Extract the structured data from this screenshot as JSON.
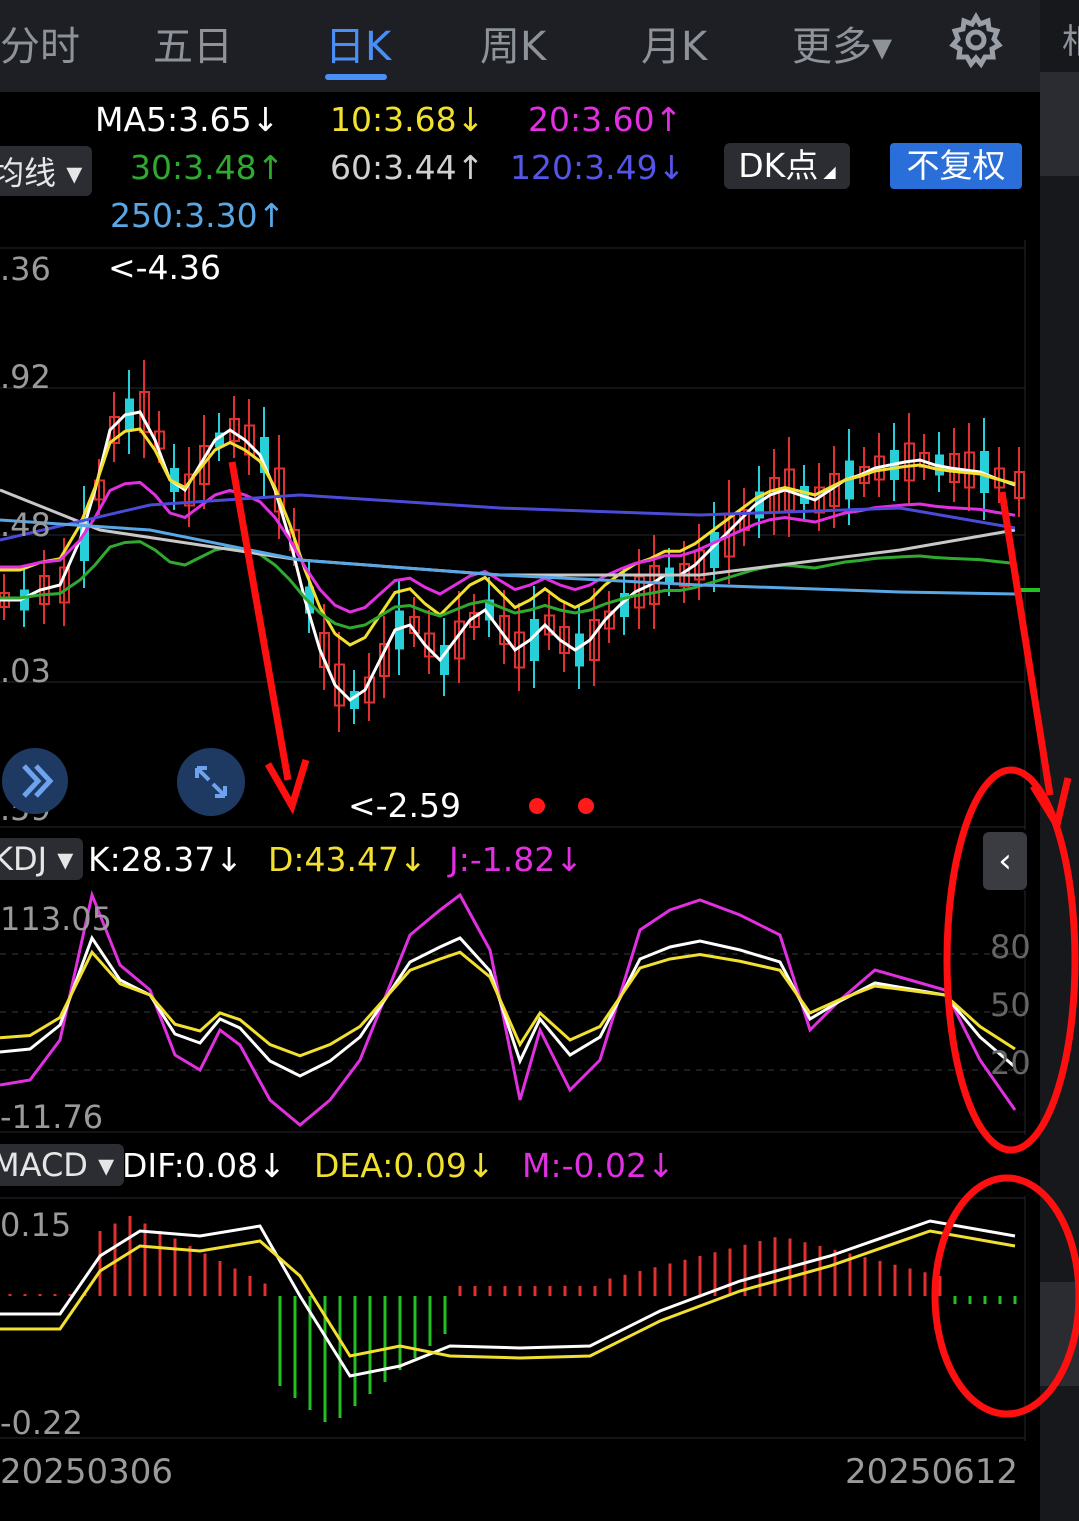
{
  "tabs": [
    {
      "label": "分时"
    },
    {
      "label": "五日"
    },
    {
      "label": "日K"
    },
    {
      "label": "周K"
    },
    {
      "label": "月K"
    },
    {
      "label": "更多▾"
    }
  ],
  "right_tab_partial": "相",
  "ma_legend": {
    "indicator_select": "均线",
    "ma5": "MA5:3.65↓",
    "ma10": "10:3.68↓",
    "ma20": "20:3.60↑",
    "ma30": "30:3.48↑",
    "ma60": "60:3.44↑",
    "ma120": "120:3.49↓",
    "ma250": "250:3.30↑",
    "dk_button": "DK点",
    "fuquan_button": "不复权"
  },
  "price_axis": {
    "l1": ".36",
    "l2": ".92",
    "l3": ".48",
    "l4": ".03",
    "l5": ".59"
  },
  "price_high_label": "<-4.36",
  "price_low_label": "<-2.59",
  "kdj": {
    "select": "KDJ",
    "k": "K:28.37↓",
    "d": "D:43.47↓",
    "j": "J:-1.82↓",
    "axis_top": "113.05",
    "axis_bottom": "-11.76",
    "level_80": "80",
    "level_50": "50",
    "level_20": "20"
  },
  "macd": {
    "select": "MACD",
    "dif": "DIF:0.08↓",
    "dea": "DEA:0.09↓",
    "m": "M:-0.02↓",
    "axis_top": "0.15",
    "axis_bottom": "-0.22"
  },
  "dates": {
    "start": "20250306",
    "end": "20250612"
  },
  "colors": {
    "up": "#e03030",
    "down": "#27d0d8",
    "ma5": "#ffffff",
    "ma10": "#f2e030",
    "ma20": "#e030e0",
    "ma30": "#2faa2f",
    "ma60": "#c8c8c8",
    "ma120": "#4b4bd8",
    "ma250": "#5aa7e6",
    "annotation": "#ff1010",
    "accent": "#4a8ff5"
  }
}
